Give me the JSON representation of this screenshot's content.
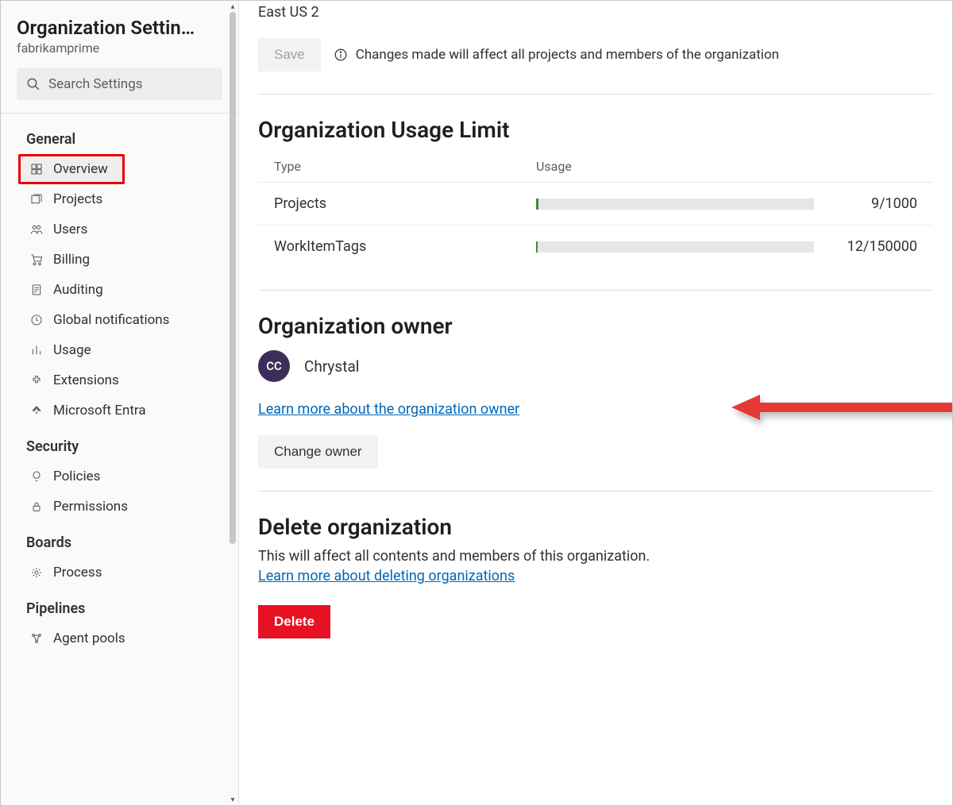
{
  "sidebar": {
    "title": "Organization Settin…",
    "org": "fabrikamprime",
    "searchPlaceholder": "Search Settings",
    "groups": [
      {
        "label": "General",
        "items": [
          {
            "key": "overview",
            "label": "Overview",
            "icon": "overview-icon",
            "selected": true,
            "highlight": true
          },
          {
            "key": "projects",
            "label": "Projects",
            "icon": "projects-icon"
          },
          {
            "key": "users",
            "label": "Users",
            "icon": "users-icon"
          },
          {
            "key": "billing",
            "label": "Billing",
            "icon": "billing-icon"
          },
          {
            "key": "auditing",
            "label": "Auditing",
            "icon": "auditing-icon"
          },
          {
            "key": "globalnotif",
            "label": "Global notifications",
            "icon": "notifications-icon"
          },
          {
            "key": "usage",
            "label": "Usage",
            "icon": "usage-icon"
          },
          {
            "key": "extensions",
            "label": "Extensions",
            "icon": "extensions-icon"
          },
          {
            "key": "entra",
            "label": "Microsoft Entra",
            "icon": "entra-icon"
          }
        ]
      },
      {
        "label": "Security",
        "items": [
          {
            "key": "policies",
            "label": "Policies",
            "icon": "policies-icon"
          },
          {
            "key": "permissions",
            "label": "Permissions",
            "icon": "permissions-icon"
          }
        ]
      },
      {
        "label": "Boards",
        "items": [
          {
            "key": "process",
            "label": "Process",
            "icon": "process-icon"
          }
        ]
      },
      {
        "label": "Pipelines",
        "items": [
          {
            "key": "agentpools",
            "label": "Agent pools",
            "icon": "agentpools-icon"
          }
        ]
      }
    ]
  },
  "main": {
    "region": "East US 2",
    "saveLabel": "Save",
    "saveInfo": "Changes made will affect all projects and members of the organization",
    "usageLimit": {
      "title": "Organization Usage Limit",
      "headType": "Type",
      "headUsage": "Usage",
      "rows": [
        {
          "name": "Projects",
          "used": 9,
          "limit": 1000,
          "display": "9/1000"
        },
        {
          "name": "WorkItemTags",
          "used": 12,
          "limit": 150000,
          "display": "12/150000"
        }
      ]
    },
    "owner": {
      "title": "Organization owner",
      "avatarInitials": "CC",
      "name": "Chrystal",
      "learnMore": "Learn more about the organization owner",
      "changeBtn": "Change owner"
    },
    "delete": {
      "title": "Delete organization",
      "subtext": "This will affect all contents and members of this organization.",
      "learnMore": "Learn more about deleting organizations",
      "btn": "Delete"
    }
  },
  "colors": {
    "accentLink": "#0067b8",
    "danger": "#e81123",
    "barFill": "#3b8e3b",
    "avatarBg": "#3b2e58",
    "highlightBox": "#e60000"
  }
}
